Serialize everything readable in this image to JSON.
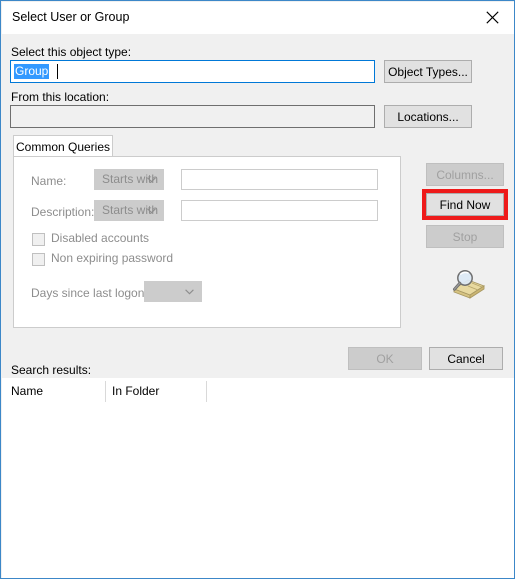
{
  "window": {
    "title": "Select User or Group",
    "close_icon": "close-icon"
  },
  "object_type": {
    "label": "Select this object type:",
    "value": "Group",
    "button_label": "Object Types..."
  },
  "location": {
    "label": "From this location:",
    "value": "",
    "button_label": "Locations..."
  },
  "tabs": [
    {
      "label": "Common Queries",
      "active": true
    }
  ],
  "query": {
    "name": {
      "label": "Name:",
      "operator": "Starts with",
      "value": "",
      "placeholder": ""
    },
    "description": {
      "label": "Description:",
      "operator": "Starts with",
      "value": "",
      "placeholder": ""
    },
    "disabled_accounts": {
      "label": "Disabled accounts",
      "checked": false
    },
    "non_expiring_password": {
      "label": "Non expiring password",
      "checked": false
    },
    "days_since_last_logon": {
      "label": "Days since last logon:",
      "value": ""
    }
  },
  "side_buttons": {
    "columns": {
      "label": "Columns...",
      "enabled": false
    },
    "find_now": {
      "label": "Find Now",
      "enabled": true,
      "highlighted": true
    },
    "stop": {
      "label": "Stop",
      "enabled": false
    },
    "icon": "find-magnifier-icon"
  },
  "footer": {
    "ok_label": "OK",
    "cancel_label": "Cancel"
  },
  "results": {
    "label": "Search results:",
    "columns": [
      "Name",
      "In Folder"
    ],
    "rows": []
  },
  "colors": {
    "window_border": "#3c87c8",
    "dialog_background": "#f0f0f0",
    "titlebar_background": "#ffffff",
    "accent_selection": "#3399ff",
    "focus_border": "#0078d7",
    "button_face": "#e1e1e1",
    "button_disabled_face": "#cccccc",
    "disabled_text": "#8d8d8d",
    "highlight_callout": "#ee1b1b"
  }
}
